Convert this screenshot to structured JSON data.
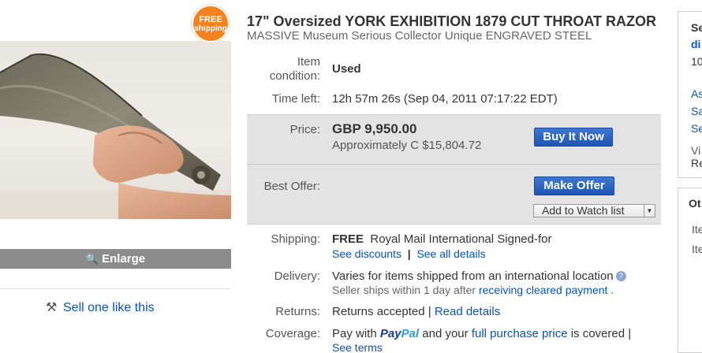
{
  "badge": {
    "line1": "FREE",
    "line2": "shipping"
  },
  "gallery": {
    "enlarge_label": "Enlarge",
    "sell_one_label": "Sell one like this"
  },
  "listing": {
    "title": "17\" Oversized YORK EXHIBITION 1879 CUT THROAT RAZOR",
    "subtitle": "MASSIVE Museum Serious Collector Unique ENGRAVED STEEL",
    "condition_label_1": "Item",
    "condition_label_2": "condition:",
    "condition_value": "Used",
    "time_left_label": "Time left:",
    "time_left_value": "12h 57m 26s (Sep 04, 2011 07:17:22 EDT)",
    "price_label": "Price:",
    "price_value": "GBP 9,950.00",
    "price_approx": "Approximately C $15,804.72",
    "buy_now_label": "Buy It Now",
    "best_offer_label": "Best Offer:",
    "make_offer_label": "Make Offer",
    "watch_label": "Add to Watch list",
    "shipping_label": "Shipping:",
    "shipping_free": "FREE",
    "shipping_method": "Royal Mail International Signed-for",
    "see_discounts": "See discounts",
    "separator": "|",
    "see_all_details": "See all details",
    "delivery_label": "Delivery:",
    "delivery_value": "Varies for items shipped from an international location",
    "ships_within": "Seller ships within 1 day after",
    "receiving_payment": "receiving cleared payment",
    "period": ".",
    "returns_label": "Returns:",
    "returns_value": "Returns accepted |",
    "read_details": "Read details",
    "coverage_label": "Coverage:",
    "coverage_pay_with": "Pay with",
    "paypal_pay": "Pay",
    "paypal_pal": "Pal",
    "coverage_and_your": "and your",
    "full_purchase_price": "full purchase price",
    "coverage_is_covered": "is covered |",
    "see_terms": "See terms"
  },
  "sidebar": {
    "se": "Se",
    "di": "di",
    "num": "10",
    "as": "As",
    "sa": "Sa",
    "se2": "Se",
    "vi": "Vi",
    "re": "Re",
    "ot": "Ot",
    "ite1": "Ite",
    "ite2": "Ite"
  },
  "colors": {
    "link": "#0654ba",
    "button": "#1f55b4",
    "badge": "#f5821f",
    "price_box": "#e3e3e3"
  }
}
